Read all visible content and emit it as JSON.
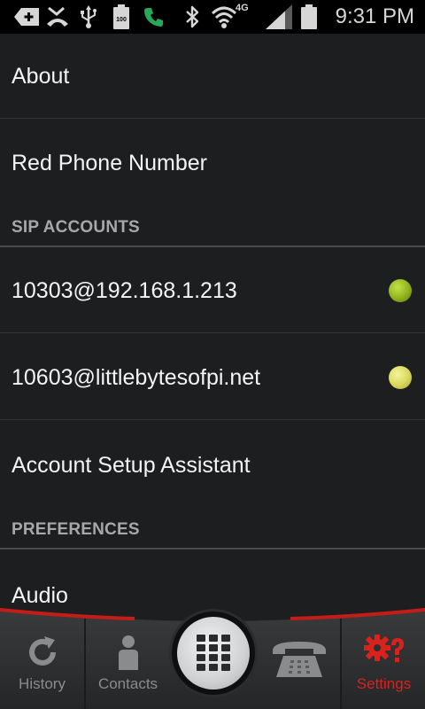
{
  "status_bar": {
    "time": "9:31 PM",
    "battery_small_label": "100",
    "network_label": "4G",
    "icons": [
      "add-notification-icon",
      "missed-call-icon",
      "usb-icon",
      "battery-saver-icon",
      "call-icon",
      "bluetooth-icon",
      "wifi-icon",
      "signal-icon",
      "battery-icon"
    ]
  },
  "settings": {
    "about": "About",
    "red_phone_number": "Red Phone Number",
    "sip_accounts_header": "SIP ACCOUNTS",
    "accounts": [
      {
        "address": "10303@192.168.1.213",
        "status_color": "#8fb21a"
      },
      {
        "address": "10603@littlebytesofpi.net",
        "status_color": "#d9d75a"
      }
    ],
    "account_setup_assistant": "Account Setup Assistant",
    "preferences_header": "PREFERENCES",
    "audio": "Audio"
  },
  "nav": {
    "history": "History",
    "contacts": "Contacts",
    "settings": "Settings",
    "active_tab": "settings",
    "active_color": "#d9221d",
    "accent_color": "#c41c17"
  }
}
